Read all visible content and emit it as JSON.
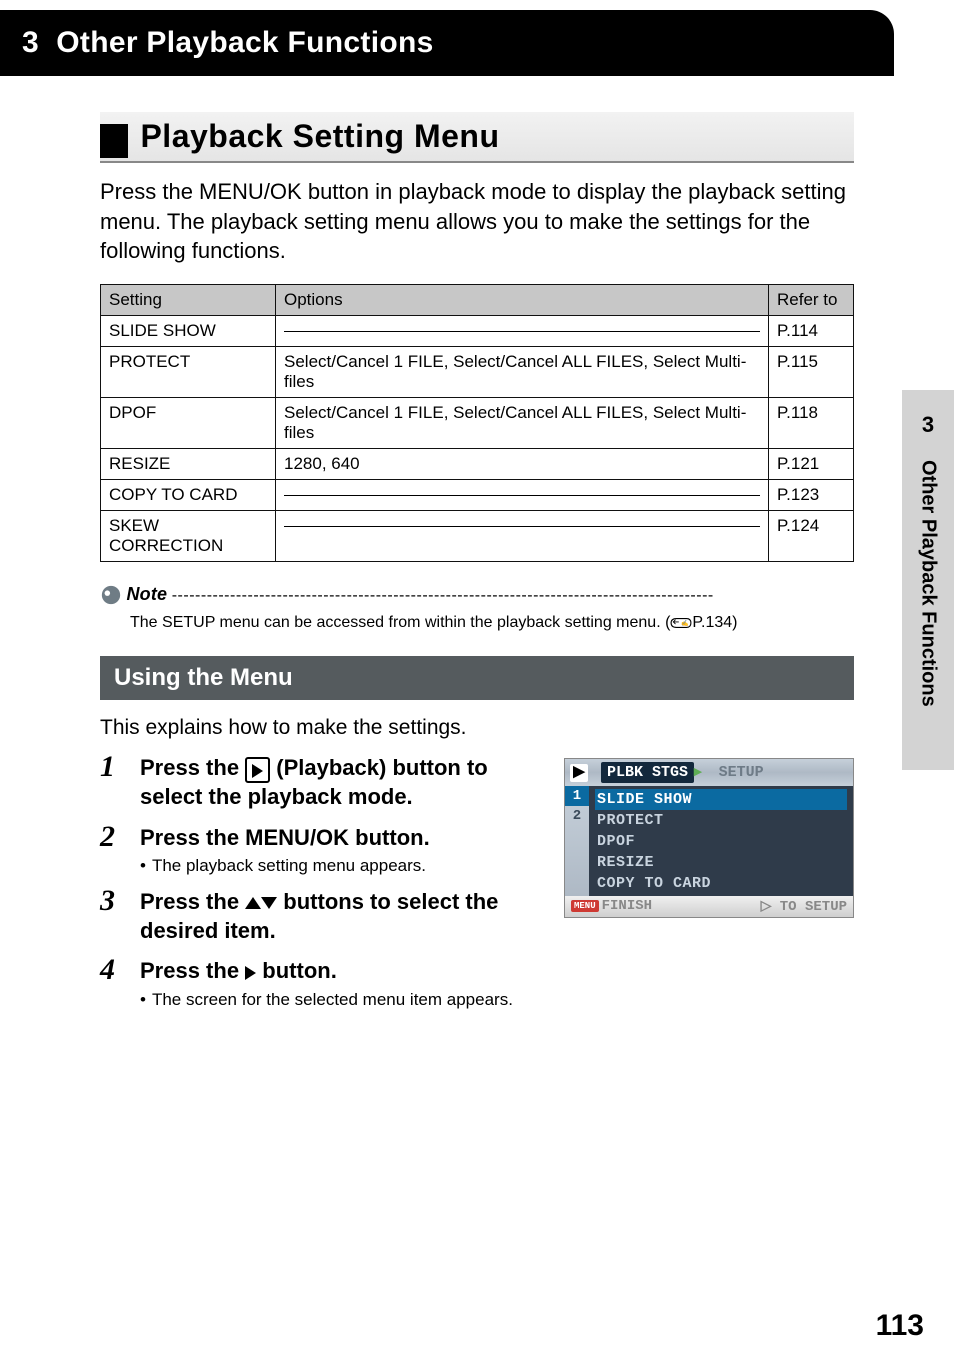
{
  "banner": {
    "number": "3",
    "title": "Other Playback Functions"
  },
  "section": {
    "title": "Playback Setting Menu",
    "intro": "Press the MENU/OK button in playback mode to display the playback setting menu. The playback setting menu allows you to make the settings for the following functions."
  },
  "table": {
    "headers": {
      "setting": "Setting",
      "options": "Options",
      "refer": "Refer to"
    },
    "rows": [
      {
        "setting": "SLIDE SHOW",
        "options": "",
        "line": true,
        "refer": "P.114"
      },
      {
        "setting": "PROTECT",
        "options": "Select/Cancel 1 FILE, Select/Cancel ALL FILES, Select Multi-files",
        "refer": "P.115"
      },
      {
        "setting": "DPOF",
        "options": "Select/Cancel 1 FILE, Select/Cancel ALL FILES, Select Multi-files",
        "refer": "P.118"
      },
      {
        "setting": "RESIZE",
        "options": "1280, 640",
        "refer": "P.121"
      },
      {
        "setting": "COPY TO CARD",
        "options": "",
        "line": true,
        "refer": "P.123"
      },
      {
        "setting": "SKEW CORRECTION",
        "options": "",
        "line": true,
        "refer": "P.124"
      }
    ]
  },
  "note": {
    "label": "Note",
    "text": "The SETUP menu can be accessed from within the playback setting menu. (",
    "pageref": "P.134)"
  },
  "subsection": {
    "title": "Using the Menu",
    "intro": "This explains how to make the settings."
  },
  "steps": [
    {
      "num": "1",
      "title_pre": "Press the ",
      "title_post": " (Playback) button to select the playback mode."
    },
    {
      "num": "2",
      "title": "Press the MENU/OK button.",
      "sub": "The playback setting menu appears."
    },
    {
      "num": "3",
      "title_pre": "Press the ",
      "title_post": " buttons to select the desired item."
    },
    {
      "num": "4",
      "title_pre": "Press the ",
      "title_post": " button.",
      "sub": "The screen for the selected menu item appears."
    }
  ],
  "lcd": {
    "tab_label": "PLBK STGS",
    "setup_label": "SETUP",
    "page1": "1",
    "page2": "2",
    "items": [
      "SLIDE SHOW",
      "PROTECT",
      "DPOF",
      "RESIZE",
      "COPY TO CARD"
    ],
    "finish": "FINISH",
    "to_setup": "TO SETUP"
  },
  "sidetab": {
    "num": "3",
    "text": "Other Playback Functions"
  },
  "page_number": "113"
}
